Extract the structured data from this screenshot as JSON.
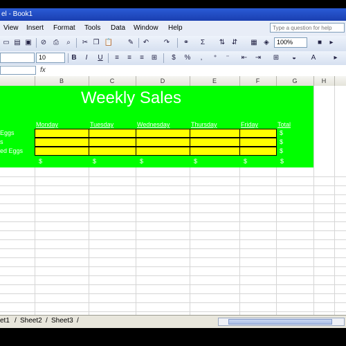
{
  "window": {
    "title": "el - Book1"
  },
  "menu": {
    "items": [
      "View",
      "Insert",
      "Format",
      "Tools",
      "Data",
      "Window",
      "Help"
    ]
  },
  "help_box": {
    "placeholder": "Type a question for help"
  },
  "toolbar": {
    "zoom": "100%",
    "font_size": "10"
  },
  "columns": [
    "B",
    "C",
    "D",
    "E",
    "F",
    "G",
    "H"
  ],
  "sheet": {
    "title": "Weekly Sales",
    "days": [
      "Monday",
      "Tuesday",
      "Wednesday",
      "Thursday",
      "Friday"
    ],
    "total_label": "Total",
    "row_labels": [
      "Eggs",
      "s",
      "ed Eggs"
    ],
    "currency_symbol": "$",
    "colors": {
      "block": "#00ff00",
      "cells": "#ffff00",
      "title": "#ffffff"
    }
  },
  "tabs": [
    "et1",
    "Sheet2",
    "Sheet3"
  ]
}
